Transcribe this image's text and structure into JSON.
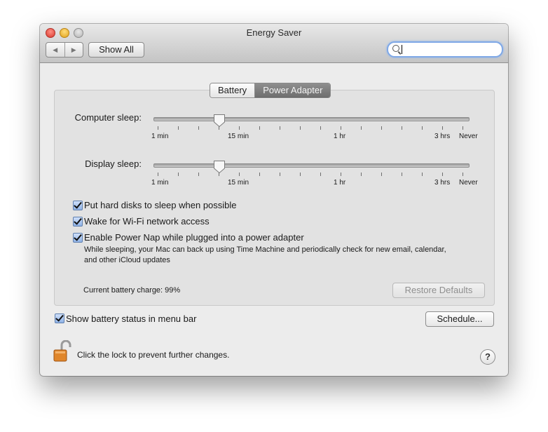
{
  "window": {
    "title": "Energy Saver"
  },
  "toolbar": {
    "back_glyph": "◀",
    "forward_glyph": "▶",
    "show_all_label": "Show All",
    "search_value": ""
  },
  "tabs": [
    {
      "label": "Battery",
      "selected": false
    },
    {
      "label": "Power Adapter",
      "selected": true
    }
  ],
  "sliders": {
    "computer_sleep": {
      "label": "Computer sleep:",
      "value": "15 min"
    },
    "display_sleep": {
      "label": "Display sleep:",
      "value": "15 min"
    },
    "tick_labels": [
      "1 min",
      "15 min",
      "1 hr",
      "3 hrs",
      "Never"
    ]
  },
  "options": [
    {
      "label": "Put hard disks to sleep when possible",
      "checked": true
    },
    {
      "label": "Wake for Wi-Fi network access",
      "checked": true
    },
    {
      "label": "Enable Power Nap while plugged into a power adapter",
      "checked": true
    }
  ],
  "power_nap_note": "While sleeping, your Mac can back up using Time Machine and periodically check for new email, calendar, and other iCloud updates",
  "battery_charge": "Current battery charge: 99%",
  "restore_defaults_label": "Restore Defaults",
  "menu_bar_option": {
    "label": "Show battery status in menu bar",
    "checked": true
  },
  "schedule_label": "Schedule...",
  "lock_text": "Click the lock to prevent further changes.",
  "help_label": "?",
  "colors": {
    "accent": "#7fa8e6",
    "selected_tab": "#7e7e7e"
  }
}
